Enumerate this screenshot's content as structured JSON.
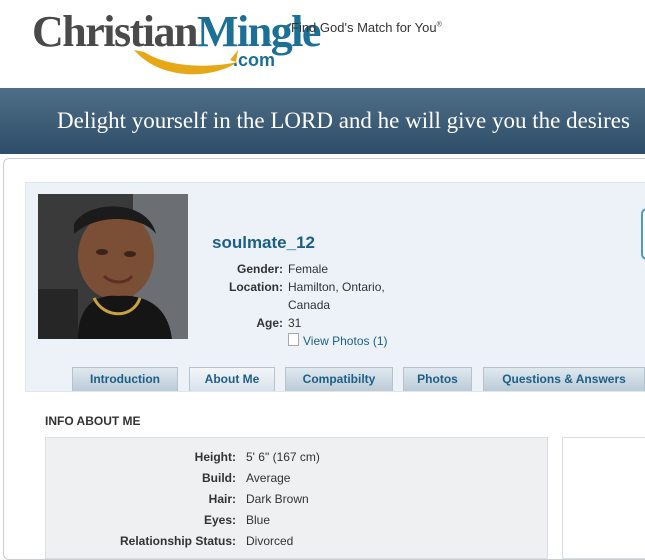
{
  "header": {
    "logo_part1": "Christian",
    "logo_part2": "Mingle",
    "logo_reg": "®",
    "logo_com": ".com",
    "tagline": "Find God's Match for You",
    "tagline_mark": "®"
  },
  "banner": {
    "text": "Delight yourself in the LORD and he will give you the desires"
  },
  "profile": {
    "username": "soulmate_12",
    "gender_label": "Gender:",
    "gender": "Female",
    "location_label": "Location:",
    "location_line1": "Hamilton, Ontario,",
    "location_line2": "Canada",
    "age_label": "Age:",
    "age": "31",
    "view_photos": "View Photos (1)"
  },
  "tabs": [
    {
      "label": "Introduction"
    },
    {
      "label": "About Me"
    },
    {
      "label": "Compatibilty"
    },
    {
      "label": "Photos"
    },
    {
      "label": "Questions & Answers"
    }
  ],
  "info": {
    "title": "INFO ABOUT ME",
    "rows": [
      {
        "label": "Height:",
        "value": "5' 6\" (167 cm)"
      },
      {
        "label": "Build:",
        "value": "Average"
      },
      {
        "label": "Hair:",
        "value": "Dark Brown"
      },
      {
        "label": "Eyes:",
        "value": "Blue"
      },
      {
        "label": "Relationship Status:",
        "value": "Divorced"
      }
    ]
  },
  "colors": {
    "brand_blue": "#1c6f95",
    "logo_gray": "#4a4a4a",
    "banner": "#3d5d78",
    "fish_gold": "#e6a817"
  }
}
